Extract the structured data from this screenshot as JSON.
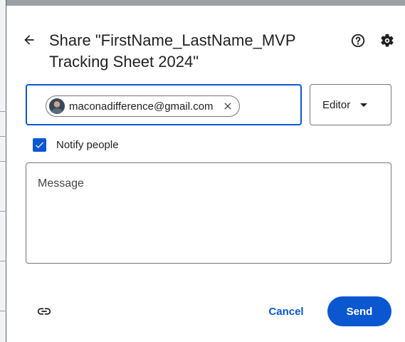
{
  "dialog": {
    "title_line1": "Share \"FirstName_LastName_MVP",
    "title_line2": "Tracking Sheet 2024\"",
    "icons": {
      "back": "arrow-back-icon",
      "help": "help-circle-icon",
      "settings": "gear-icon",
      "remove_chip": "close-icon",
      "role_dropdown": "caret-down-icon",
      "checkbox": "checkmark-icon",
      "copy_link": "link-icon"
    }
  },
  "recipients": {
    "chips": [
      {
        "email": "maconadifference@gmail.com"
      }
    ]
  },
  "role": {
    "selected": "Editor"
  },
  "notify": {
    "label": "Notify people",
    "checked": true
  },
  "message": {
    "placeholder": "Message",
    "value": ""
  },
  "footer": {
    "cancel_label": "Cancel",
    "send_label": "Send"
  },
  "colors": {
    "accent": "#0b57d0",
    "text": "#1f1f1f",
    "outline": "#747775"
  }
}
